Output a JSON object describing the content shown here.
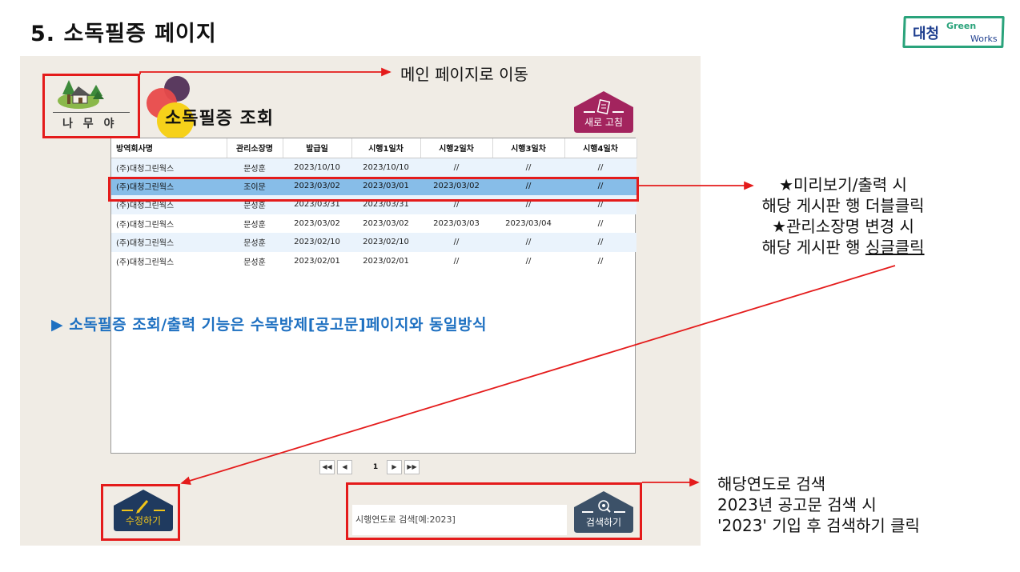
{
  "slide_title": "5. 소독필증 페이지",
  "brand": {
    "korean": "대청",
    "green": "Green",
    "works": "Works"
  },
  "logo": {
    "label": "나 무 야"
  },
  "page_title": "소독필증 조회",
  "buttons": {
    "refresh": "새로 고침",
    "edit": "수정하기",
    "search": "검색하기"
  },
  "table": {
    "headers": [
      "방역회사명",
      "관리소장명",
      "발급일",
      "시행1일차",
      "시행2일차",
      "시행3일차",
      "시행4일차"
    ],
    "rows": [
      [
        "(주)대청그린웍스",
        "문성훈",
        "2023/10/10",
        "2023/10/10",
        "//",
        "//",
        "//"
      ],
      [
        "(주)대청그린웍스",
        "조이문",
        "2023/03/02",
        "2023/03/01",
        "2023/03/02",
        "//",
        "//"
      ],
      [
        "(주)대청그린웍스",
        "문성훈",
        "2023/03/31",
        "2023/03/31",
        "//",
        "//",
        "//"
      ],
      [
        "(주)대청그린웍스",
        "문성훈",
        "2023/03/02",
        "2023/03/02",
        "2023/03/03",
        "2023/03/04",
        "//"
      ],
      [
        "(주)대청그린웍스",
        "문성훈",
        "2023/02/10",
        "2023/02/10",
        "//",
        "//",
        "//"
      ],
      [
        "(주)대청그린웍스",
        "문성훈",
        "2023/02/01",
        "2023/02/01",
        "//",
        "//",
        "//"
      ]
    ],
    "selected_row": 1
  },
  "pager": {
    "first": "◀◀",
    "prev": "◀",
    "page": "1",
    "next": "▶",
    "last": "▶▶"
  },
  "search": {
    "placeholder": "시행연도로 검색[예:2023]"
  },
  "annotations": {
    "main_page": "메인 페이지로 이동",
    "row_note_1": "★미리보기/출력 시",
    "row_note_2": "해당 게시판 행 더블클릭",
    "row_note_3": "★관리소장명 변경 시",
    "row_note_4a": "해당 게시판 행 ",
    "row_note_4b": "싱글클릭",
    "blue_note": "▶ 소독필증 조회/출력 기능은 수목방제[공고문]페이지와 동일방식",
    "search_note_1": "해당연도로 검색",
    "search_note_2": "2023년 공고문 검색 시",
    "search_note_3": "'2023' 기입 후 검색하기 클릭"
  },
  "colors": {
    "red": "#e41b1b",
    "blue_note": "#1e70c1",
    "selected_row": "#87bde8",
    "alt_row": "#eaf3fc",
    "refresh_button": "#a3245e",
    "navy_button": "#1f3a5f",
    "edit_label": "#f0c419"
  }
}
